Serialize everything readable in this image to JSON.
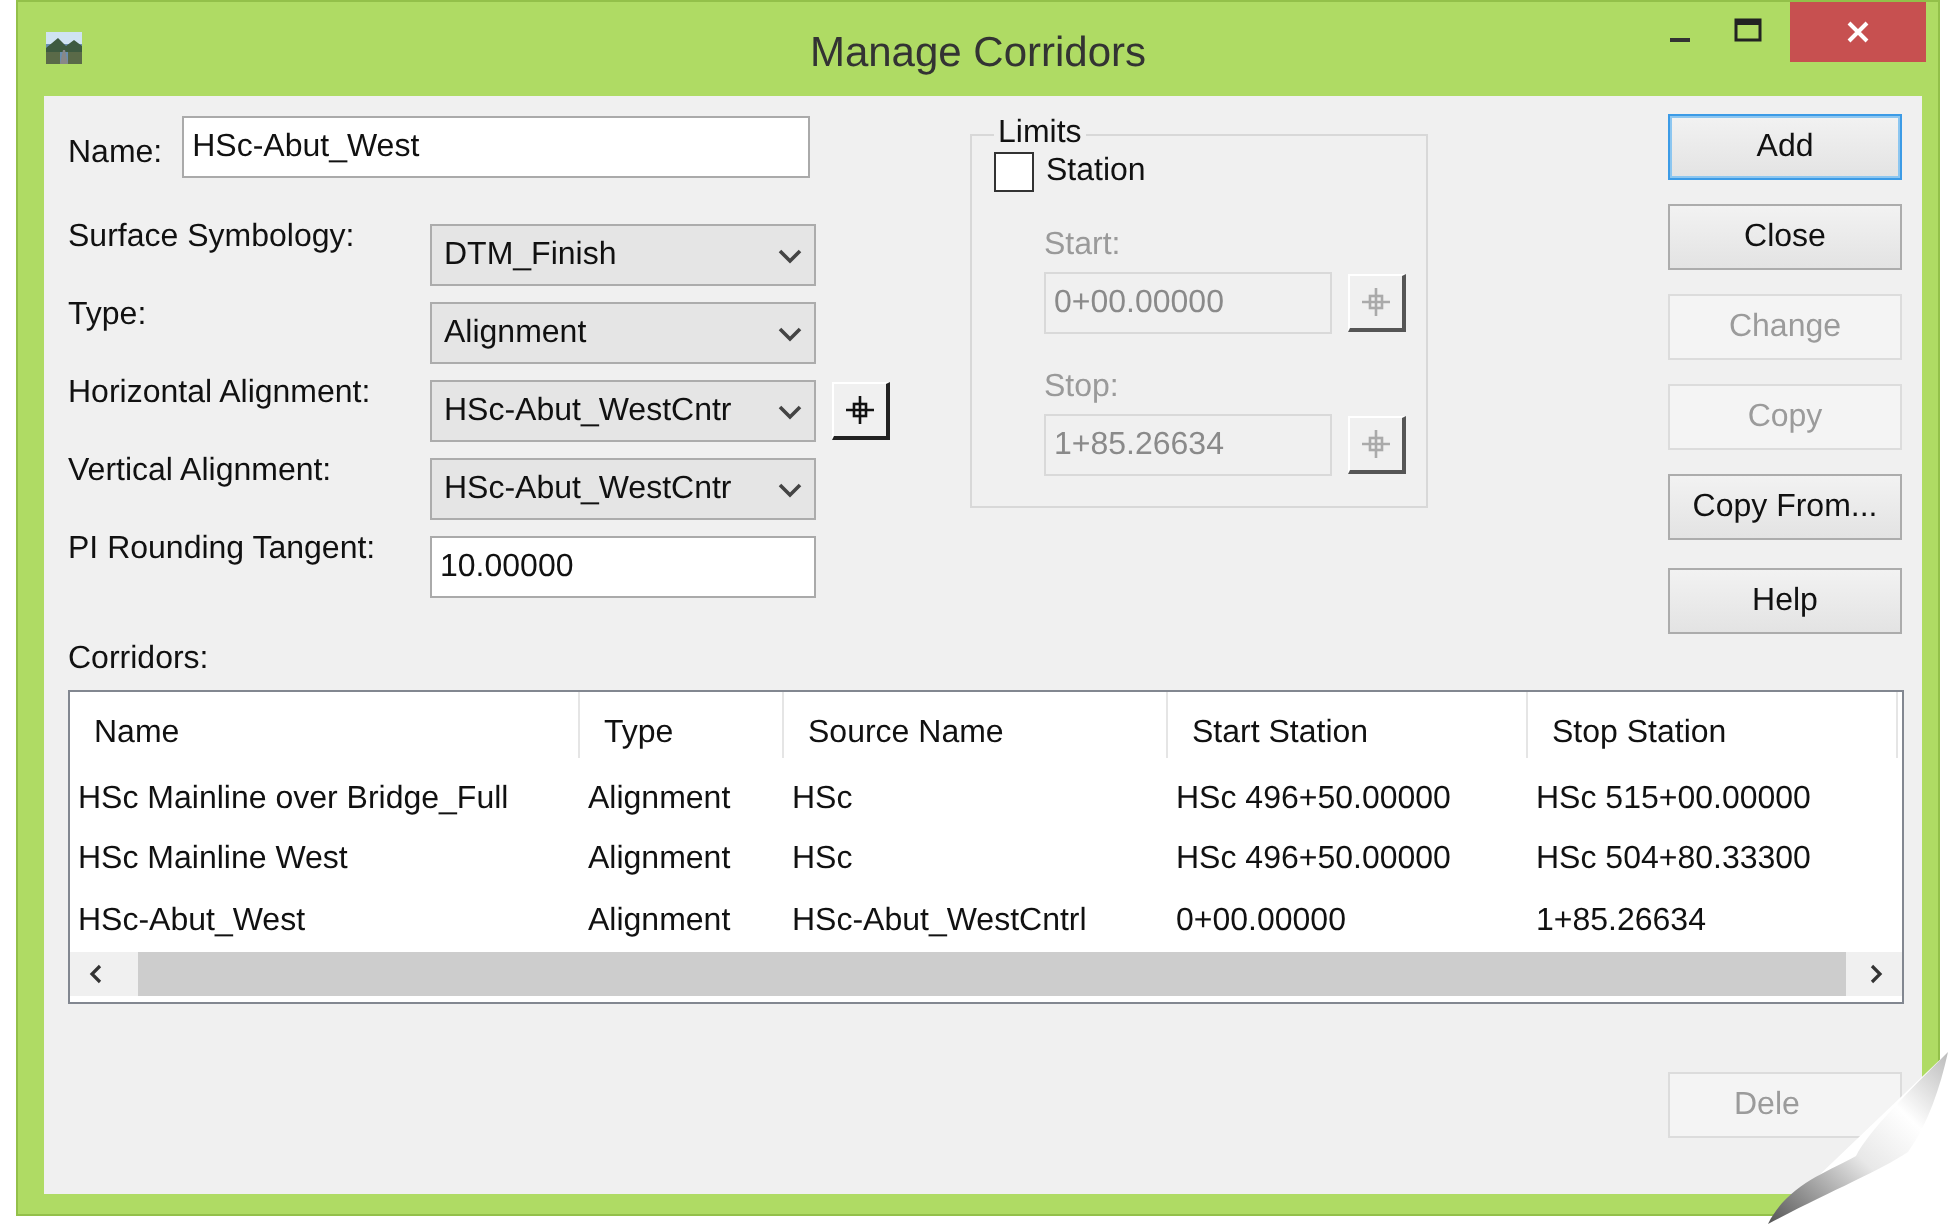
{
  "window": {
    "title": "Manage Corridors"
  },
  "form": {
    "name": {
      "label": "Name:",
      "value": "HSc-Abut_West"
    },
    "rows": [
      {
        "kind": "combo",
        "label": "Surface Symbology:",
        "value": "DTM_Finish",
        "pick_button": false
      },
      {
        "kind": "combo",
        "label": "Type:",
        "value": "Alignment",
        "pick_button": false
      },
      {
        "kind": "combo",
        "label": "Horizontal Alignment:",
        "value": "HSc-Abut_WestCntr",
        "pick_button": true
      },
      {
        "kind": "combo",
        "label": "Vertical Alignment:",
        "value": "HSc-Abut_WestCntr",
        "pick_button": false
      },
      {
        "kind": "text",
        "label": "PI Rounding Tangent:",
        "value": "10.00000",
        "pick_button": false
      }
    ]
  },
  "limits": {
    "title": "Limits",
    "station": {
      "label": "Station",
      "checked": false
    },
    "start": {
      "label": "Start:",
      "value": "0+00.00000"
    },
    "stop": {
      "label": "Stop:",
      "value": "1+85.26634"
    }
  },
  "buttons": [
    {
      "label": "Add",
      "disabled": false,
      "default": true
    },
    {
      "label": "Close",
      "disabled": false,
      "default": false
    },
    {
      "label": "Change",
      "disabled": true,
      "default": false
    },
    {
      "label": "Copy",
      "disabled": true,
      "default": false
    },
    {
      "label": "Copy From...",
      "disabled": false,
      "default": false
    },
    {
      "label": "Help",
      "disabled": false,
      "default": false
    }
  ],
  "corridors": {
    "label": "Corridors:",
    "columns": [
      "Name",
      "Type",
      "Source Name",
      "Start Station",
      "Stop Station"
    ],
    "rows": [
      [
        "HSc Mainline over Bridge_Full",
        "Alignment",
        "HSc",
        "HSc 496+50.00000",
        "HSc 515+00.00000"
      ],
      [
        "HSc Mainline West",
        "Alignment",
        "HSc",
        "HSc 496+50.00000",
        "HSc 504+80.33300"
      ],
      [
        "HSc-Abut_West",
        "Alignment",
        "HSc-Abut_WestCntrl",
        "0+00.00000",
        "1+85.26634"
      ]
    ]
  },
  "delete_button": {
    "label": "Dele",
    "disabled": true
  }
}
